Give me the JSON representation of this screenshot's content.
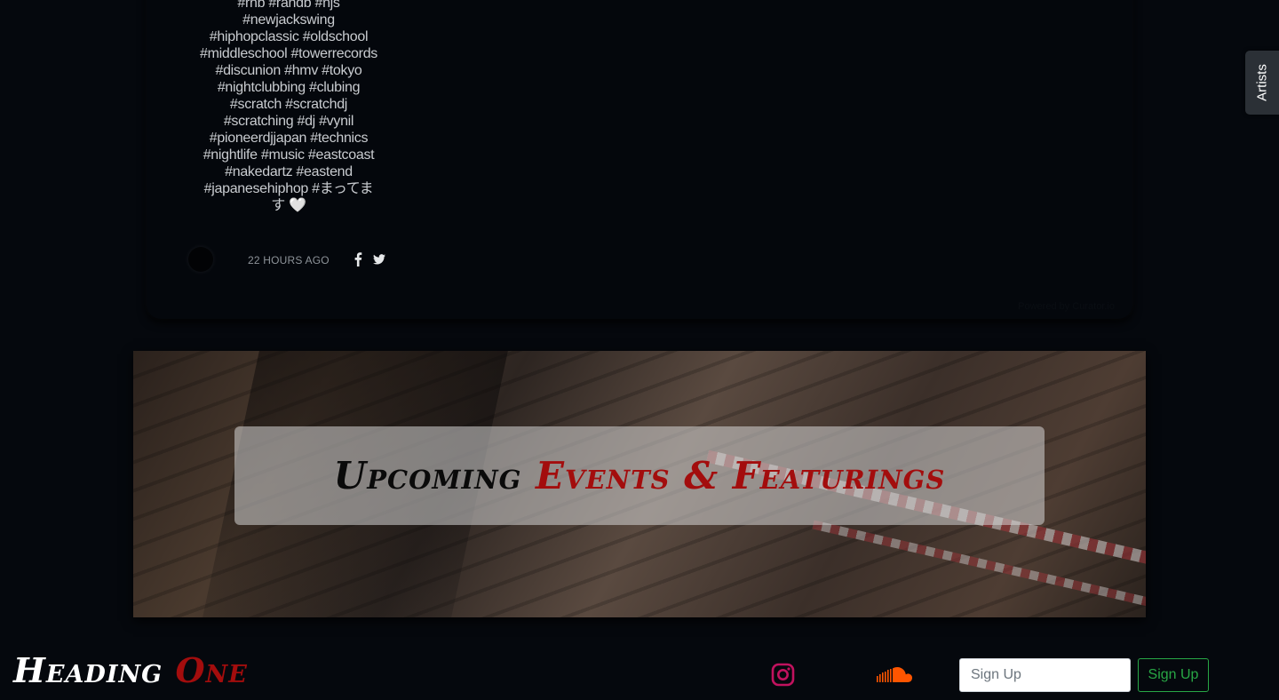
{
  "feed": {
    "post_lines": [
      "#rnb #randb #njs",
      "#newjackswing",
      "#hiphopclassic #oldschool",
      "#middleschool #towerrecords",
      "#discunion #hmv #tokyo",
      "#nightclubbing #clubing",
      "#scratch #scratchdj",
      "#scratching #dj #vynil",
      "#pioneerdjjapan #technics",
      "#nightlife #music #eastcoast",
      "#nakedartz #eastend",
      "#japanesehiphop #まってま",
      "す 🤍"
    ],
    "timestamp": "22 HOURS AGO",
    "share_icons": [
      "facebook-icon",
      "twitter-icon"
    ],
    "powered_by": "Powered by Curator.io"
  },
  "side_tab": {
    "label": "Artists"
  },
  "events_banner": {
    "title_part1": "Upcoming ",
    "title_part2": "Events & Featurings",
    "accent_color": "#a30d0d"
  },
  "footer": {
    "heading_part1": "Heading ",
    "heading_part2": "One",
    "instagram_icon": "instagram-icon",
    "instagram_color": "#c1125e",
    "soundcloud_icon": "soundcloud-icon",
    "soundcloud_color": "#ff5500",
    "signup_placeholder": "Sign Up",
    "signup_button_label": "Sign Up",
    "signup_button_color": "#28a745"
  }
}
